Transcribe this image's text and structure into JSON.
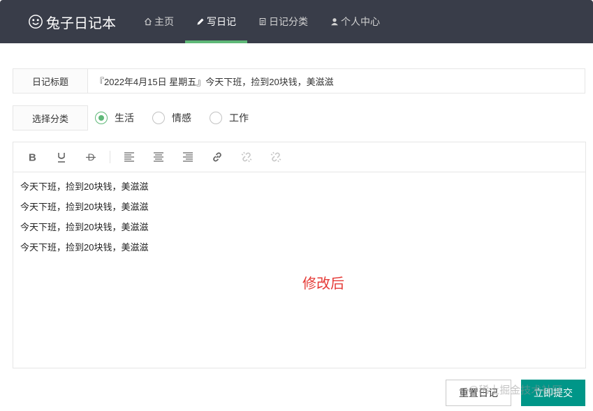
{
  "header": {
    "logo_text": "兔子日记本",
    "nav": [
      {
        "label": "主页",
        "icon": "home-icon"
      },
      {
        "label": "写日记",
        "icon": "pencil-icon"
      },
      {
        "label": "日记分类",
        "icon": "document-icon"
      },
      {
        "label": "个人中心",
        "icon": "user-icon"
      }
    ],
    "active_nav": "写日记"
  },
  "form": {
    "title_label": "日记标题",
    "title_value": "『2022年4月15日 星期五』今天下班，捡到20块钱，美滋滋",
    "category_label": "选择分类",
    "categories": [
      {
        "label": "生活",
        "checked": true
      },
      {
        "label": "情感",
        "checked": false
      },
      {
        "label": "工作",
        "checked": false
      }
    ]
  },
  "editor": {
    "toolbar": [
      "bold-icon",
      "underline-icon",
      "strikethrough-icon",
      "align-left-icon",
      "align-center-icon",
      "align-right-icon",
      "link-icon",
      "unlink-icon",
      "unlink-icon"
    ],
    "lines": [
      "今天下班，捡到20块钱，美滋滋",
      "今天下班，捡到20块钱，美滋滋",
      "今天下班，捡到20块钱，美滋滋",
      "今天下班，捡到20块钱，美滋滋"
    ],
    "annotation": "修改后"
  },
  "buttons": {
    "reset_label": "重置日记",
    "submit_label": "立即提交"
  },
  "watermark_text": "@稀土掘金技术社区",
  "colors": {
    "header_bg": "#393d49",
    "active_underline": "#5fb878",
    "submit_bg": "#009688",
    "annotation": "#e53935"
  }
}
